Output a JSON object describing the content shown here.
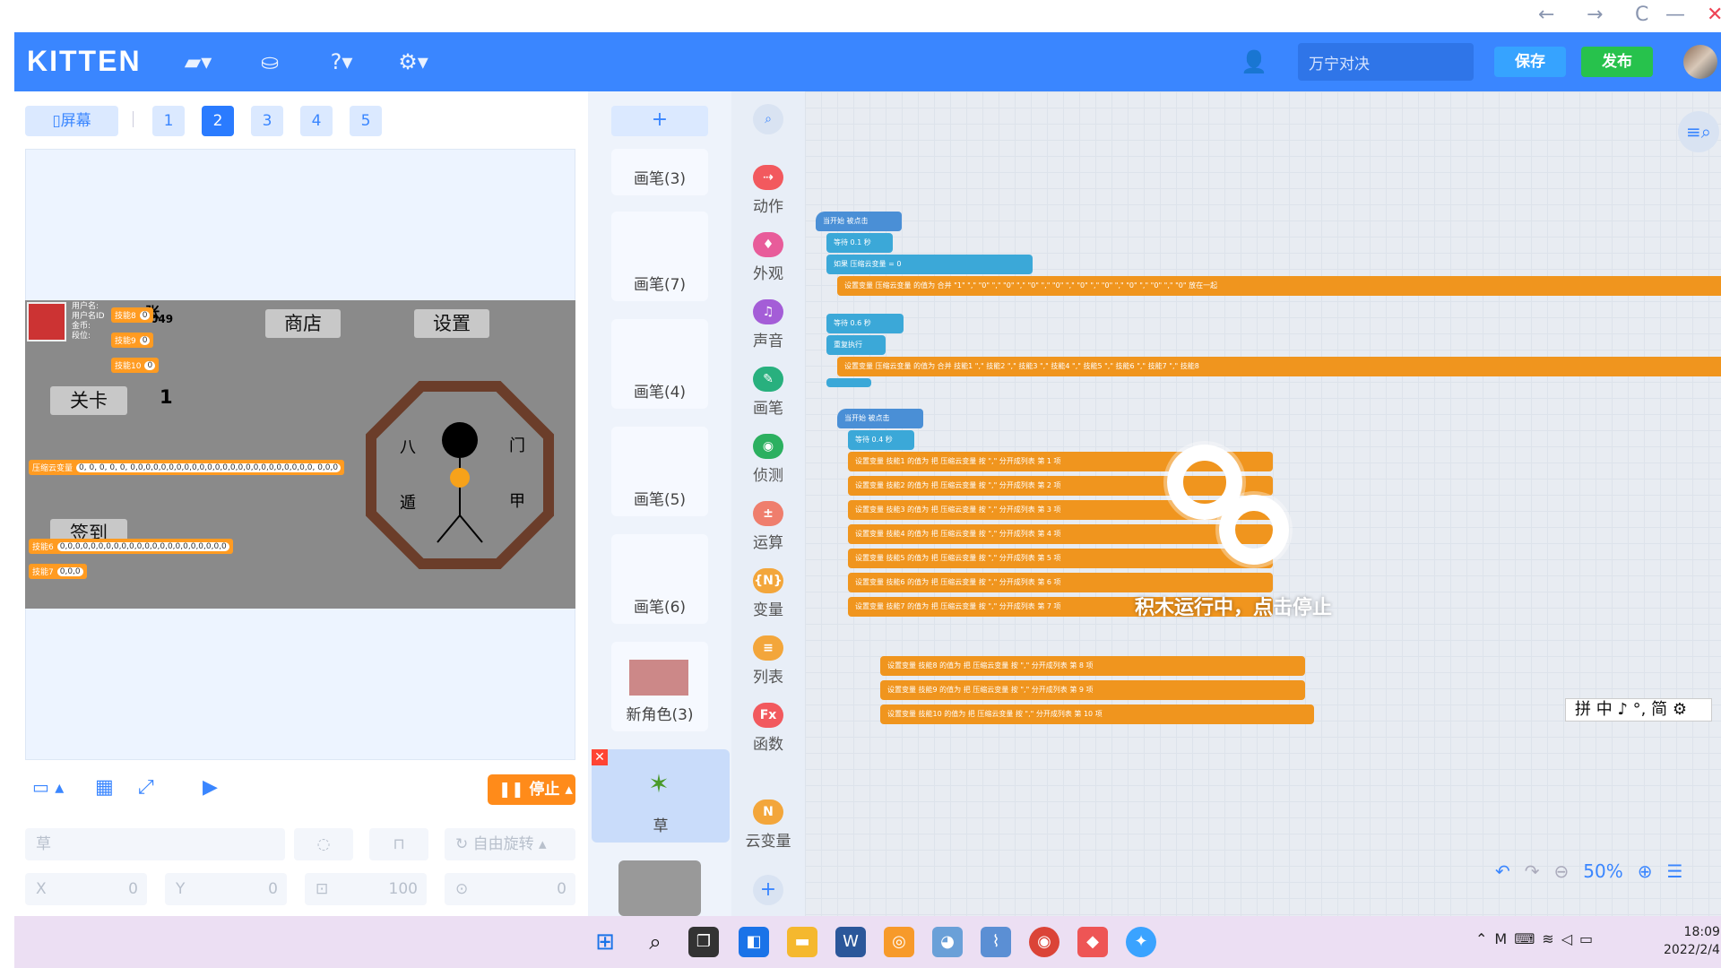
{
  "window": {
    "back": "←",
    "forward": "→",
    "reload": "C",
    "minimize": "—",
    "close": "✕"
  },
  "topbar": {
    "logo": "KITTEN",
    "project_name": "万宁对决",
    "save": "保存",
    "publish": "发布"
  },
  "stage_tabs": {
    "screen": "屏幕",
    "pages": [
      "1",
      "2",
      "3",
      "4",
      "5"
    ],
    "active": "2"
  },
  "game": {
    "shop": "商店",
    "settings": "设置",
    "level": "关卡",
    "level_num": "1",
    "checkin": "签到",
    "user_lines": [
      "用户名:",
      "用户名ID",
      "金币:",
      "段位:"
    ],
    "partial_name": "张",
    "partial_id": "049",
    "skill8": "技能8",
    "skill8_val": "0",
    "skill9": "技能9",
    "skill9_val": "0",
    "skill10": "技能10",
    "skill10_val": "0",
    "cloud_label": "压缩云变量",
    "cloud_val": "0, 0, 0, 0, 0, 0,0,0,0,0,0,0,0,0,0,0,0,0,0,0,0,0,0,0,0,0,0,0,0, 0,0,0",
    "skill6": "技能6",
    "skill6_val": "0,0,0,0,0,0,0,0,0,0,0,0,0,0,0,0,0,0,0,0,0,0",
    "skill7": "技能7",
    "skill7_val": "0,0,0",
    "bagua": [
      "八",
      "门",
      "遁",
      "甲"
    ]
  },
  "controls": {
    "stop": "停止",
    "sprite_name": "草",
    "rotation": "自由旋转",
    "x_label": "X",
    "x_val": "0",
    "y_label": "Y",
    "y_val": "0",
    "size_val": "100",
    "dir_val": "0"
  },
  "sprites": [
    "画笔(3)",
    "画笔(7)",
    "画笔(4)",
    "画笔(5)",
    "画笔(6)",
    "新角色(3)",
    "草"
  ],
  "categories": [
    {
      "name": "动作",
      "color": "#f2595e",
      "icon": "⇢"
    },
    {
      "name": "外观",
      "color": "#e85c9a",
      "icon": "♦"
    },
    {
      "name": "声音",
      "color": "#a45dd7",
      "icon": "♫"
    },
    {
      "name": "画笔",
      "color": "#28b07e",
      "icon": "✎"
    },
    {
      "name": "侦测",
      "color": "#2cb060",
      "icon": "◉"
    },
    {
      "name": "运算",
      "color": "#ef7e6d",
      "icon": "±"
    },
    {
      "name": "变量",
      "color": "#f3a63b",
      "icon": "{N}"
    },
    {
      "name": "列表",
      "color": "#f3a63b",
      "icon": "≡"
    },
    {
      "name": "函数",
      "color": "#f2595e",
      "icon": "Fx"
    },
    {
      "name": "云变量",
      "color": "#f3a63b",
      "icon": "N"
    }
  ],
  "blocks": {
    "hat1": "当开始 被点击",
    "wait1": "等待 0.1 秒",
    "if1": "如果 压缩云变量 = 0",
    "set_cloud": "设置变量 压缩云变量 的值为 合并 \"1\" \",\" \"0\" \",\" \"0\" \",\" \"0\" \",\" \"0\" \",\" \"0\" \",\" \"0\" \",\" \"0\" \",\" \"0\" \",\" \"0\" 放在一起",
    "wait2": "等待 0.6 秒",
    "repeat": "重复执行",
    "set_cloud2": "设置变量 压缩云变量 的值为 合并 技能1 \",\" 技能2 \",\" 技能3 \",\" 技能4 \",\" 技能5 \",\" 技能6 \",\" 技能7 \",\" 技能8",
    "hat2": "当开始 被点击",
    "wait3": "等待 0.4 秒",
    "skill_rows": [
      "设置变量 技能1 的值为 把 压缩云变量 按 \",\" 分开成列表 第 1 项",
      "设置变量 技能2 的值为 把 压缩云变量 按 \",\" 分开成列表 第 2 项",
      "设置变量 技能3 的值为 把 压缩云变量 按 \",\" 分开成列表 第 3 项",
      "设置变量 技能4 的值为 把 压缩云变量 按 \",\" 分开成列表 第 4 项",
      "设置变量 技能5 的值为 把 压缩云变量 按 \",\" 分开成列表 第 5 项",
      "设置变量 技能6 的值为 把 压缩云变量 按 \",\" 分开成列表 第 6 项",
      "设置变量 技能7 的值为 把 压缩云变量 按 \",\" 分开成列表 第 7 项"
    ],
    "skill_rows2": [
      "设置变量 技能8 的值为 把 压缩云变量 按 \",\" 分开成列表 第 8 项",
      "设置变量 技能9 的值为 把 压缩云变量 按 \",\" 分开成列表 第 9 项",
      "设置变量 技能10 的值为 把 压缩云变量 按 \",\" 分开成列表 第 10 项"
    ]
  },
  "overlay": "积木运行中，点击停止",
  "ime": "拼 中 ♪ °, 简 ⚙",
  "zoom": "50%",
  "clock": {
    "time": "18:09",
    "date": "2022/2/4"
  }
}
